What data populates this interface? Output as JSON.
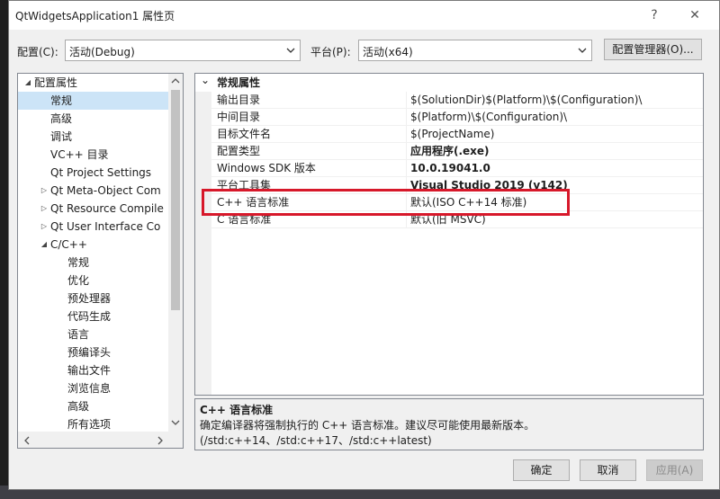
{
  "window": {
    "title": "QtWidgetsApplication1 属性页",
    "help_symbol": "?",
    "close_symbol": "✕"
  },
  "toolbar": {
    "config_label": "配置(C):",
    "config_value": "活动(Debug)",
    "platform_label": "平台(P):",
    "platform_value": "活动(x64)",
    "config_manager_label": "配置管理器(O)..."
  },
  "tree": {
    "items": [
      {
        "label": "配置属性",
        "expander": "◢",
        "selected": false
      },
      {
        "label": "常规",
        "expander": "",
        "selected": true
      },
      {
        "label": "高级",
        "expander": "",
        "selected": false
      },
      {
        "label": "调试",
        "expander": "",
        "selected": false
      },
      {
        "label": "VC++ 目录",
        "expander": "",
        "selected": false
      },
      {
        "label": "Qt Project Settings",
        "expander": "",
        "selected": false
      },
      {
        "label": "Qt Meta-Object Com",
        "expander": "▷",
        "selected": false
      },
      {
        "label": "Qt Resource Compile",
        "expander": "▷",
        "selected": false
      },
      {
        "label": "Qt User Interface Co",
        "expander": "▷",
        "selected": false
      },
      {
        "label": "C/C++",
        "expander": "◢",
        "selected": false
      },
      {
        "label": "常规",
        "expander": "",
        "selected": false
      },
      {
        "label": "优化",
        "expander": "",
        "selected": false
      },
      {
        "label": "预处理器",
        "expander": "",
        "selected": false
      },
      {
        "label": "代码生成",
        "expander": "",
        "selected": false
      },
      {
        "label": "语言",
        "expander": "",
        "selected": false
      },
      {
        "label": "预编译头",
        "expander": "",
        "selected": false
      },
      {
        "label": "输出文件",
        "expander": "",
        "selected": false
      },
      {
        "label": "浏览信息",
        "expander": "",
        "selected": false
      },
      {
        "label": "高级",
        "expander": "",
        "selected": false
      },
      {
        "label": "所有选项",
        "expander": "",
        "selected": false
      }
    ]
  },
  "properties": {
    "category": "常规属性",
    "category_expander": "⌄",
    "rows": [
      {
        "name": "输出目录",
        "value": "$(SolutionDir)$(Platform)\\$(Configuration)\\",
        "bold": false
      },
      {
        "name": "中间目录",
        "value": "$(Platform)\\$(Configuration)\\",
        "bold": false
      },
      {
        "name": "目标文件名",
        "value": "$(ProjectName)",
        "bold": false
      },
      {
        "name": "配置类型",
        "value": "应用程序(.exe)",
        "bold": true
      },
      {
        "name": "Windows SDK 版本",
        "value": "10.0.19041.0",
        "bold": true
      },
      {
        "name": "平台工具集",
        "value": "Visual Studio 2019 (v142)",
        "bold": true
      },
      {
        "name": "C++ 语言标准",
        "value": "默认(ISO C++14 标准)",
        "bold": false
      },
      {
        "name": "C 语言标准",
        "value": "默认(旧 MSVC)",
        "bold": false
      }
    ]
  },
  "description": {
    "title": "C++ 语言标准",
    "text": "确定编译器将强制执行的 C++ 语言标准。建议尽可能使用最新版本。(/std:c++14、/std:c++17、/std:c++latest)"
  },
  "footer": {
    "ok_label": "确定",
    "cancel_label": "取消",
    "apply_label": "应用(A)"
  },
  "colors": {
    "selection": "#cce4f7",
    "highlight_box": "#d7182a",
    "dialog_bg": "#f0f0f0"
  }
}
